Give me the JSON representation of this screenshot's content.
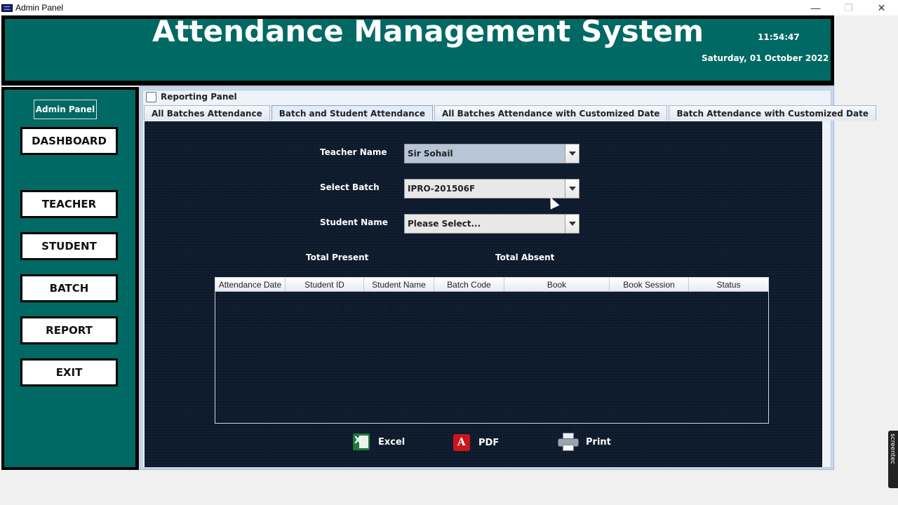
{
  "window": {
    "title": "Admin Panel",
    "minimize_label": "—",
    "maximize_label": "❐",
    "close_label": "✕"
  },
  "header": {
    "title": "Attendance Management System",
    "time": "11:54:47",
    "date": "Saturday, 01 October 2022"
  },
  "sidebar": {
    "admin_tag": "Admin Panel",
    "items": [
      {
        "label": "DASHBOARD"
      },
      {
        "label": "TEACHER"
      },
      {
        "label": "STUDENT"
      },
      {
        "label": "BATCH"
      },
      {
        "label": "REPORT"
      },
      {
        "label": "EXIT"
      }
    ]
  },
  "panel": {
    "title": "Reporting Panel",
    "tabs": [
      {
        "label": "All Batches Attendance"
      },
      {
        "label": "Batch and Student Attendance",
        "active": true
      },
      {
        "label": "All Batches Attendance with Customized Date"
      },
      {
        "label": "Batch Attendance with Customized Date"
      }
    ]
  },
  "form": {
    "teacher_label": "Teacher Name",
    "teacher_value": "Sir Sohail",
    "batch_label": "Select Batch",
    "batch_value": "IPRO-201506F",
    "student_label": "Student Name",
    "student_value": "Please Select...",
    "total_present_label": "Total Present",
    "total_absent_label": "Total Absent"
  },
  "table": {
    "columns": [
      "Attendance Date",
      "Student ID",
      "Student Name",
      "Batch Code",
      "Book",
      "Book Session",
      "Status"
    ],
    "rows": []
  },
  "actions": {
    "excel": "Excel",
    "pdf": "PDF",
    "print": "Print"
  },
  "watermark": {
    "text": "screentec"
  },
  "colors": {
    "header_bg": "#006964",
    "content_bg": "#0d1a2b"
  }
}
